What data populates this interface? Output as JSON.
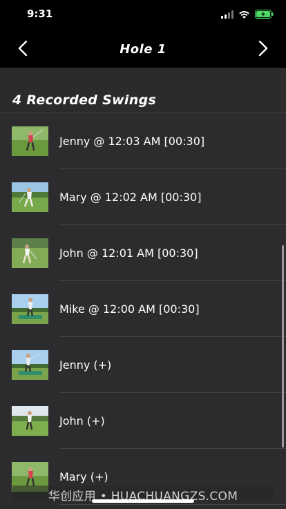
{
  "status_bar": {
    "time": "9:31",
    "icons": [
      "cellular-signal-icon",
      "wifi-icon",
      "battery-charging-icon"
    ],
    "battery_color": "#4cd964"
  },
  "nav": {
    "title": "Hole 1",
    "back_icon": "chevron-left-icon",
    "forward_icon": "chevron-right-icon"
  },
  "section": {
    "title": "4 Recorded Swings"
  },
  "rows": [
    {
      "label": "Jenny @ 12:03 AM [00:30]",
      "thumbnail": "golfer-swing-thumbnail"
    },
    {
      "label": "Mary @ 12:02 AM [00:30]",
      "thumbnail": "golfer-swing-thumbnail"
    },
    {
      "label": "John @ 12:01 AM [00:30]",
      "thumbnail": "golfer-swing-thumbnail"
    },
    {
      "label": "Mike @ 12:00 AM [00:30]",
      "thumbnail": "golfer-swing-thumbnail"
    },
    {
      "label": "Jenny (+)",
      "thumbnail": "golfer-swing-thumbnail"
    },
    {
      "label": "John (+)",
      "thumbnail": "golfer-swing-thumbnail"
    },
    {
      "label": "Mary (+)",
      "thumbnail": "golfer-swing-thumbnail"
    }
  ],
  "watermark": "华创应用 • HUACHUANGZS.COM"
}
